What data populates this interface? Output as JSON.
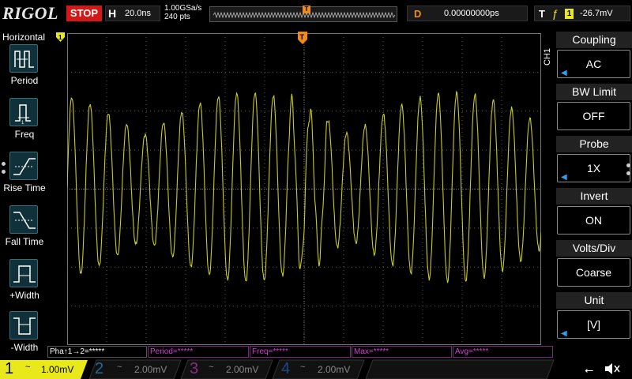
{
  "brand": {
    "logo": "RIGOL"
  },
  "status": {
    "run_state": "STOP",
    "run_state_color": "#d41818"
  },
  "horizontal": {
    "letter": "H",
    "timebase": "20.0ns",
    "sample_rate": "1.00GSa/s",
    "points": "240 pts"
  },
  "delay": {
    "letter": "D",
    "value": "0.00000000ps"
  },
  "trigger": {
    "letter": "T",
    "edge_icon": "rising-edge-icon",
    "channel": "1",
    "level": "-26.7mV",
    "marker": "T"
  },
  "left_menu": {
    "title": "Horizontal",
    "items": [
      {
        "label": "Period",
        "icon": "period-icon"
      },
      {
        "label": "Freq",
        "icon": "freq-icon"
      },
      {
        "label": "Rise Time",
        "icon": "rise-time-icon"
      },
      {
        "label": "Fall Time",
        "icon": "fall-time-icon"
      },
      {
        "label": "+Width",
        "icon": "pos-width-icon"
      },
      {
        "label": "-Width",
        "icon": "neg-width-icon"
      }
    ]
  },
  "right_menu": {
    "channel_tag": "CH1",
    "items": [
      {
        "title": "Coupling",
        "value": "AC",
        "has_arrow": true
      },
      {
        "title": "BW Limit",
        "value": "OFF",
        "has_arrow": false
      },
      {
        "title": "Probe",
        "value": "1X",
        "has_arrow": true
      },
      {
        "title": "Invert",
        "value": "ON",
        "has_arrow": false
      },
      {
        "title": "Volts/Div",
        "value": "Coarse",
        "has_arrow": false
      },
      {
        "title": "Unit",
        "value": "[V]",
        "has_arrow": true
      }
    ]
  },
  "measurements": [
    {
      "text": "Pha↑1→2=*****"
    },
    {
      "text": "Period=*****"
    },
    {
      "text": "Freq=*****"
    },
    {
      "text": "Max=*****"
    },
    {
      "text": "Avg=*****"
    }
  ],
  "channels": [
    {
      "number": "1",
      "coupling": "~",
      "volts_div": "1.00mV",
      "active": true,
      "color": "#e8e81a"
    },
    {
      "number": "2",
      "coupling": "~",
      "volts_div": "2.00mV",
      "active": false,
      "color": "#2fa0f0"
    },
    {
      "number": "3",
      "coupling": "~",
      "volts_div": "2.00mV",
      "active": false,
      "color": "#d43fd4"
    },
    {
      "number": "4",
      "coupling": "~",
      "volts_div": "2.00mV",
      "active": false,
      "color": "#1f6fd0"
    }
  ],
  "status_icons": {
    "usb": "usb-icon",
    "sound": "speaker-muted-icon"
  },
  "colors": {
    "ch1_trace": "#c9c92a",
    "grid": "#5a5a5a",
    "trigger_marker": "#f28a1b"
  }
}
